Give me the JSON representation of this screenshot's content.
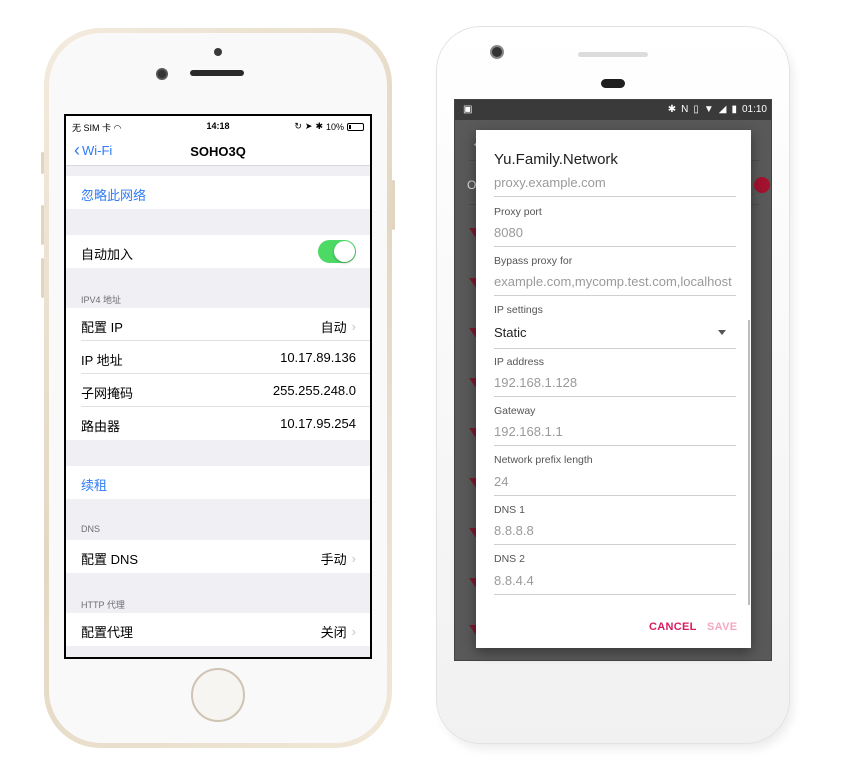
{
  "ios": {
    "status": {
      "carrier": "无 SIM 卡",
      "time": "14:18",
      "battery": "10%"
    },
    "nav": {
      "back_label": "Wi-Fi",
      "title": "SOHO3Q"
    },
    "forget_network": "忽略此网络",
    "auto_join": {
      "label": "自动加入",
      "enabled": true
    },
    "ipv4_header": "IPV4 地址",
    "ipv4_rows": [
      {
        "label": "配置 IP",
        "value": "自动"
      },
      {
        "label": "IP 地址",
        "value": "10.17.89.136"
      },
      {
        "label": "子网掩码",
        "value": "255.255.248.0"
      },
      {
        "label": "路由器",
        "value": "10.17.95.254"
      }
    ],
    "renew_lease": "续租",
    "dns_header": "DNS",
    "dns_row": {
      "label": "配置 DNS",
      "value": "手动"
    },
    "proxy_header": "HTTP 代理",
    "proxy_row": {
      "label": "配置代理",
      "value": "关闭"
    },
    "accent_color": "#2f7cf6",
    "toggle_color": "#4cd964"
  },
  "android": {
    "status": {
      "time": "01:10"
    },
    "bg_letter": "O",
    "dialog": {
      "title": "Yu.Family.Network",
      "proxy_host_placeholder": "proxy.example.com",
      "proxy_port_label": "Proxy port",
      "proxy_port_placeholder": "8080",
      "bypass_label": "Bypass proxy for",
      "bypass_placeholder": "example.com,mycomp.test.com,localhost",
      "ip_settings_label": "IP settings",
      "ip_settings_value": "Static",
      "ip_address_label": "IP address",
      "ip_address_placeholder": "192.168.1.128",
      "gateway_label": "Gateway",
      "gateway_placeholder": "192.168.1.1",
      "prefix_label": "Network prefix length",
      "prefix_placeholder": "24",
      "dns1_label": "DNS 1",
      "dns1_placeholder": "8.8.8.8",
      "dns2_label": "DNS 2",
      "dns2_placeholder": "8.8.4.4",
      "cancel_label": "CANCEL",
      "save_label": "SAVE"
    },
    "accent_color": "#d81b60"
  }
}
